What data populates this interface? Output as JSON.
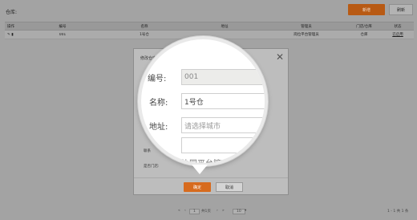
{
  "page": {
    "title": "仓库:",
    "add_label": "新增",
    "refresh_label": "刷新"
  },
  "table": {
    "headers": [
      "操作",
      "编号",
      "名称",
      "地址",
      "管理员",
      "门店/仓库",
      "状态"
    ],
    "rows": [
      {
        "code": "001",
        "name": "1号仓",
        "address": "",
        "manager": "岗位平台管理员",
        "store_type": "仓库",
        "status": "已启用"
      }
    ]
  },
  "pager": {
    "page_input": "1",
    "total_pages": "共1页",
    "page_size": "10",
    "summary": "1 - 1  共 1 条"
  },
  "modal": {
    "title": "修改仓库",
    "close_glyph": "✕",
    "bg_left_label": "联系",
    "bg_store_label": "是否门店:",
    "confirm_label": "确定",
    "cancel_label": "取消"
  },
  "lens": {
    "code_label": "编号:",
    "code_value": "001",
    "name_label": "名称:",
    "name_value": "1号仓",
    "addr_label": "地址:",
    "addr_placeholder": "请选择城市",
    "bottom_text": "协同平台管理"
  },
  "colors": {
    "accent": "#d76b1e",
    "overlay": "#a3a3a3"
  }
}
